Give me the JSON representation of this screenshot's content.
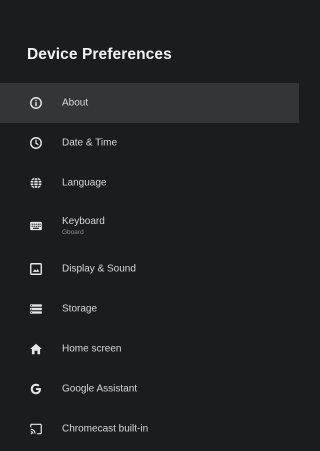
{
  "header": {
    "title": "Device Preferences"
  },
  "menu": {
    "items": [
      {
        "label": "About",
        "icon": "info-icon"
      },
      {
        "label": "Date & Time",
        "icon": "clock-icon"
      },
      {
        "label": "Language",
        "icon": "globe-icon"
      },
      {
        "label": "Keyboard",
        "sublabel": "Gboard",
        "icon": "keyboard-icon"
      },
      {
        "label": "Display & Sound",
        "icon": "display-icon"
      },
      {
        "label": "Storage",
        "icon": "storage-icon"
      },
      {
        "label": "Home screen",
        "icon": "home-icon"
      },
      {
        "label": "Google Assistant",
        "icon": "google-g-icon"
      },
      {
        "label": "Chromecast built-in",
        "icon": "cast-icon"
      }
    ]
  },
  "colors": {
    "background": "#1b1c1e",
    "selected_row": "#333537",
    "text": "#d7d8da",
    "subtext": "#8d8f93"
  }
}
